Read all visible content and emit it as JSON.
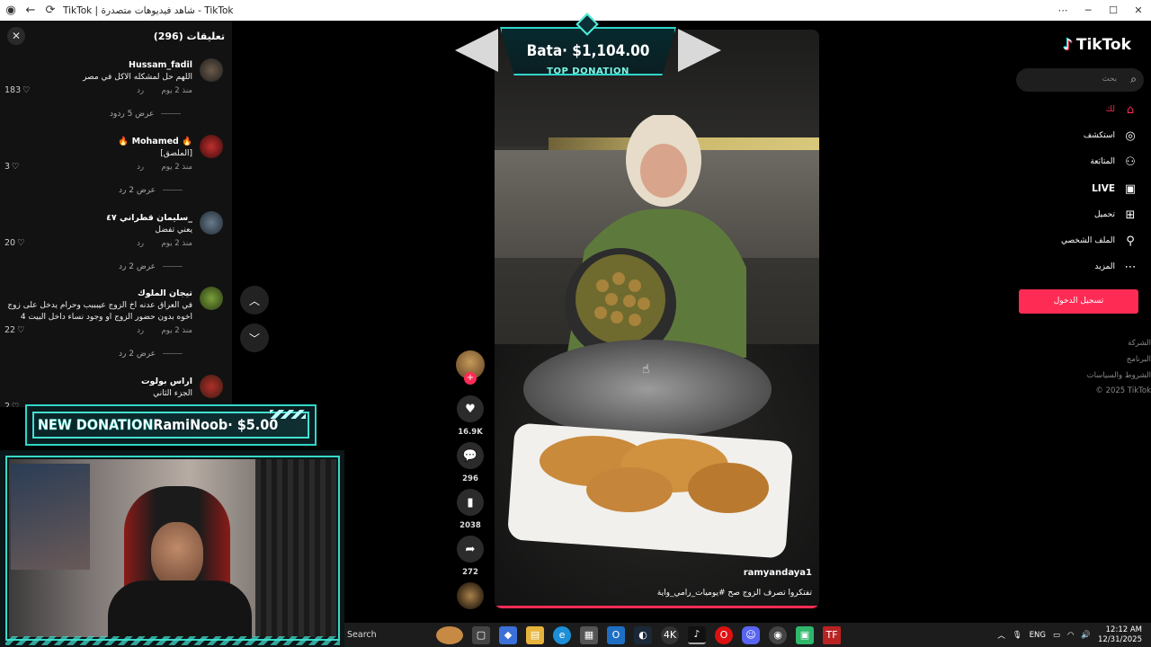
{
  "browser": {
    "title": "TikTok | شاهد فيديوهات متصدرة - TikTok",
    "back_icon": "arrow-left-icon",
    "reload_icon": "reload-icon"
  },
  "comments": {
    "title": "تعليقات (296)",
    "items": [
      {
        "user": "Hussam_fadil",
        "text": "اللهم حل لمشكله الاكل في مصر",
        "time": "منذ 2 يوم",
        "reply": "رد",
        "likes": "183",
        "replies": "عرض 5 ردود"
      },
      {
        "user": "Mohamed",
        "text": "[الملصق]",
        "time": "منذ 2 يوم",
        "reply": "رد",
        "likes": "3",
        "replies": "عرض 2 رد"
      },
      {
        "user": "سليمان قطراني ٤٧_",
        "text": "يعني تفضل",
        "time": "منذ 2 يوم",
        "reply": "رد",
        "likes": "20",
        "replies": "عرض 2 رد"
      },
      {
        "user": "تيجان الملوك",
        "text": "في العراق عدنه اخ الزوج عيبببب وحرام يدخل على زوج اخوه بدون حضور الزوج او وجود نساء داخل البيت 4",
        "time": "منذ 2 يوم",
        "reply": "رد",
        "likes": "22",
        "replies": "عرض 2 رد"
      },
      {
        "user": "اراس بولوت",
        "text": "الجزء الثاني",
        "time": "",
        "reply": "",
        "likes": "2",
        "replies": ""
      }
    ]
  },
  "overlay": {
    "top_donation_amount": "Bata· $1,104.00",
    "top_donation_label": "TOP DONATION",
    "new_donation_label": "NEW DONATION",
    "new_donation_text": "RamiNoob· $5.00"
  },
  "video": {
    "author": "ramyandaya1",
    "caption": "تفتكروا تصرف الزوج صح #يوميات_رامي_واية",
    "progress": 1.0
  },
  "actions": {
    "likes": "16.9K",
    "comments": "296",
    "saves": "2038",
    "shares": "272"
  },
  "sidebar": {
    "logo": "TikTok",
    "search_placeholder": "بحث",
    "items": [
      {
        "label": "لك",
        "icon": "home-icon"
      },
      {
        "label": "استكشف",
        "icon": "compass-icon"
      },
      {
        "label": "المتابَعة",
        "icon": "user-plus-icon"
      },
      {
        "label": "LIVE",
        "icon": "live-icon"
      },
      {
        "label": "تحميل",
        "icon": "upload-icon"
      },
      {
        "label": "الملف الشخصي",
        "icon": "profile-icon"
      },
      {
        "label": "المزيد",
        "icon": "more-icon"
      }
    ],
    "login_label": "تسجيل الدخول",
    "footer": [
      "الشركة",
      "البرنامج",
      "الشروط والسياسات",
      "© 2025 TikTok"
    ]
  },
  "taskbar": {
    "search_label": "Search",
    "lang": "ENG",
    "time": "12:12 AM",
    "date": "12/31/2025"
  },
  "colors": {
    "accent": "#fe2c55",
    "overlay_teal": "#2fd6c7"
  }
}
